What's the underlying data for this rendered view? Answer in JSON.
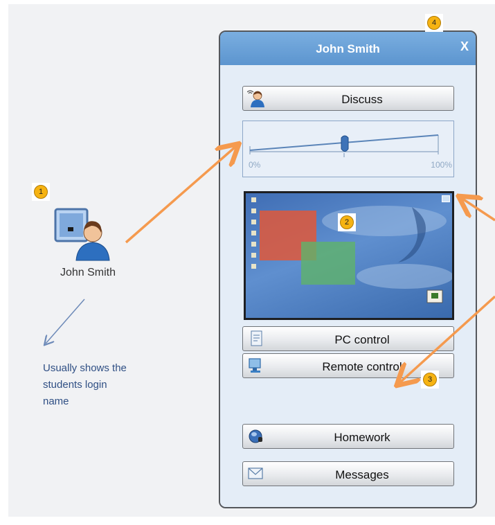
{
  "badges": [
    "1",
    "2",
    "3",
    "4"
  ],
  "student": {
    "name": "John Smith",
    "note_lines": [
      "Usually shows the",
      "students login",
      "name"
    ]
  },
  "panel": {
    "title": "John Smith",
    "close_label": "X",
    "discuss_label": "Discuss",
    "slider": {
      "min_label": "0%",
      "max_label": "100%",
      "value_percent": 50
    },
    "pc_control_label": "PC control",
    "remote_control_label": "Remote control",
    "homework_label": "Homework",
    "messages_label": "Messages"
  },
  "colors": {
    "arrow_orange": "#f59a4e",
    "arrow_blue": "#6d8ab8",
    "header_blue": "#6aa2d8",
    "badge_yellow": "#f6b312"
  },
  "icons": [
    "student-computer-icon",
    "broadcast-user-icon",
    "document-icon",
    "monitor-icon",
    "headset-icon",
    "envelope-icon",
    "maximize-icon"
  ]
}
